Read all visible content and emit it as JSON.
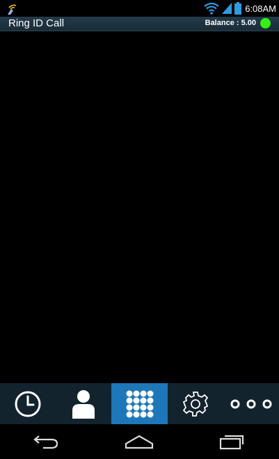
{
  "status_bar": {
    "time": "6:08AM",
    "icons": [
      "app-notification-icon",
      "wifi-icon",
      "signal-icon",
      "battery-icon"
    ]
  },
  "header": {
    "title": "Ring ID Call",
    "balance": "Balance : 5.00",
    "status_color": "#35f014"
  },
  "tabs": [
    {
      "name": "recents",
      "icon": "clock-icon",
      "active": false
    },
    {
      "name": "contacts",
      "icon": "person-icon",
      "active": false
    },
    {
      "name": "dialpad",
      "icon": "dialpad-icon",
      "active": true
    },
    {
      "name": "settings",
      "icon": "gear-icon",
      "active": false
    },
    {
      "name": "more",
      "icon": "more-icon",
      "active": false
    }
  ],
  "nav_bar": {
    "icons": [
      "back-icon",
      "home-icon",
      "recent-apps-icon"
    ]
  },
  "colors": {
    "header_bg": "#1a2c38",
    "tab_bar_bg": "#13232e",
    "active_tab": "#1d77b8"
  }
}
